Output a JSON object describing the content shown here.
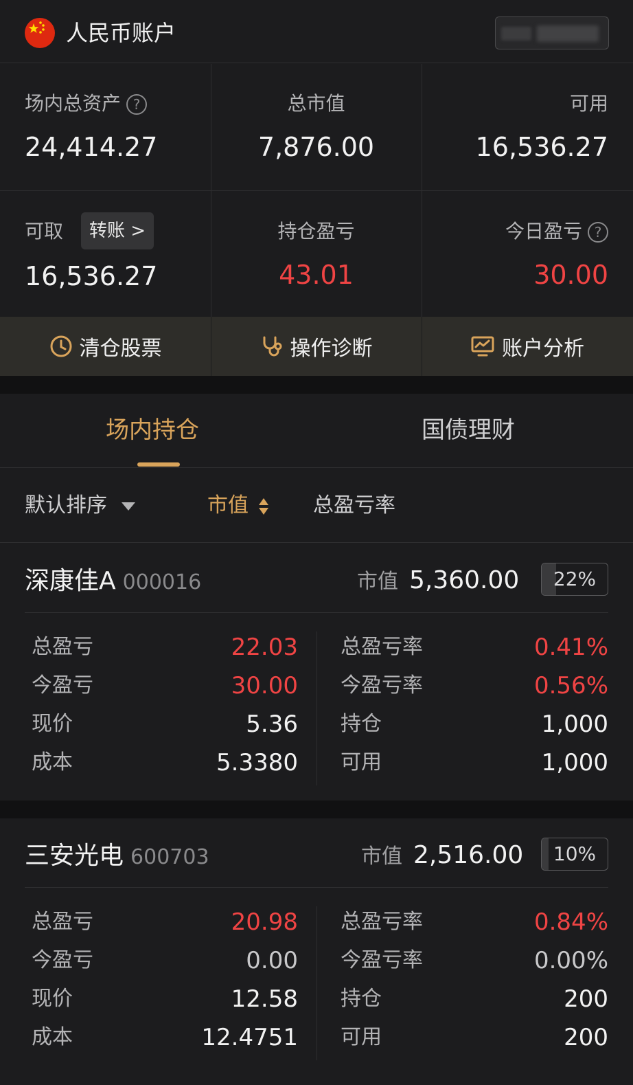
{
  "account": {
    "title": "人民币账户"
  },
  "summary": {
    "total_assets_label": "场内总资产",
    "total_assets_value": "24,414.27",
    "market_value_label": "总市值",
    "market_value_value": "7,876.00",
    "available_label": "可用",
    "available_value": "16,536.27",
    "withdrawable_label": "可取",
    "withdrawable_value": "16,536.27",
    "transfer_label": "转账 >",
    "position_pnl_label": "持仓盈亏",
    "position_pnl_value": "43.01",
    "today_pnl_label": "今日盈亏",
    "today_pnl_value": "30.00",
    "help_glyph": "?"
  },
  "actions": [
    {
      "label": "清仓股票",
      "icon": "clock-icon"
    },
    {
      "label": "操作诊断",
      "icon": "stethoscope-icon"
    },
    {
      "label": "账户分析",
      "icon": "monitor-chart-icon"
    }
  ],
  "tabs": [
    {
      "label": "场内持仓",
      "active": true
    },
    {
      "label": "国债理财",
      "active": false
    }
  ],
  "sort": {
    "default_label": "默认排序",
    "market_value_label": "市值",
    "total_pnl_rate_label": "总盈亏率"
  },
  "colors": {
    "accent": "#d9a45b",
    "loss_gain_red": "#ef4444",
    "background": "#1c1c1e"
  },
  "holdings": [
    {
      "name": "深康佳A",
      "code": "000016",
      "mv_label": "市值",
      "mv_value": "5,360.00",
      "weight_pct": "22%",
      "weight": 0.22,
      "left": [
        {
          "label": "总盈亏",
          "value": "22.03",
          "red": true
        },
        {
          "label": "今盈亏",
          "value": "30.00",
          "red": true
        },
        {
          "label": "现价",
          "value": "5.36",
          "red": false
        },
        {
          "label": "成本",
          "value": "5.3380",
          "red": false
        }
      ],
      "right": [
        {
          "label": "总盈亏率",
          "value": "0.41%",
          "red": true
        },
        {
          "label": "今盈亏率",
          "value": "0.56%",
          "red": true
        },
        {
          "label": "持仓",
          "value": "1,000",
          "red": false
        },
        {
          "label": "可用",
          "value": "1,000",
          "red": false
        }
      ]
    },
    {
      "name": "三安光电",
      "code": "600703",
      "mv_label": "市值",
      "mv_value": "2,516.00",
      "weight_pct": "10%",
      "weight": 0.1,
      "left": [
        {
          "label": "总盈亏",
          "value": "20.98",
          "red": true
        },
        {
          "label": "今盈亏",
          "value": "0.00",
          "red": false
        },
        {
          "label": "现价",
          "value": "12.58",
          "red": false
        },
        {
          "label": "成本",
          "value": "12.4751",
          "red": false
        }
      ],
      "right": [
        {
          "label": "总盈亏率",
          "value": "0.84%",
          "red": true
        },
        {
          "label": "今盈亏率",
          "value": "0.00%",
          "red": false
        },
        {
          "label": "持仓",
          "value": "200",
          "red": false
        },
        {
          "label": "可用",
          "value": "200",
          "red": false
        }
      ]
    }
  ]
}
